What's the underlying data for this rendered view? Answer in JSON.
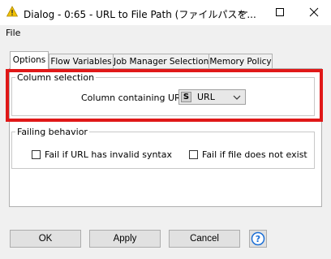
{
  "window": {
    "title": "Dialog - 0:65 - URL to File Path (ファイルパスを...",
    "icon": "warning-triangle-icon",
    "controls": [
      "minimize-icon",
      "maximize-icon",
      "close-icon"
    ]
  },
  "menu": {
    "items": [
      "File"
    ]
  },
  "tabs": [
    {
      "label": "Options",
      "active": true
    },
    {
      "label": "Flow Variables",
      "active": false
    },
    {
      "label": "Job Manager Selection",
      "active": false
    },
    {
      "label": "Memory Policy",
      "active": false
    }
  ],
  "column_selection": {
    "legend": "Column selection",
    "label": "Column containing URLs",
    "type_badge": "S",
    "selected": "URL"
  },
  "failing_behavior": {
    "legend": "Failing behavior",
    "invalid_syntax_label": "Fail if URL has invalid syntax",
    "invalid_syntax_checked": false,
    "file_missing_label": "Fail if file does not exist",
    "file_missing_checked": false
  },
  "buttons": {
    "ok": "OK",
    "apply": "Apply",
    "cancel": "Cancel",
    "help": "?"
  },
  "colors": {
    "highlight": "#e01818",
    "help_accent": "#1c6fd6",
    "warning_icon": "#f2c200"
  }
}
